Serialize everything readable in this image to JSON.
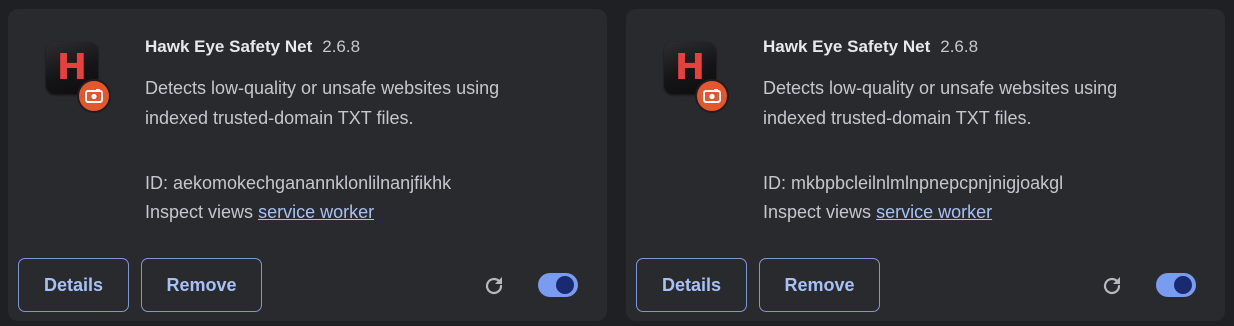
{
  "colors": {
    "page_bg": "#1f2023",
    "card_bg": "#292a2e",
    "accent": "#a8c1f5",
    "toggle_on": "#7a9cf0",
    "icon_red": "#e8413d",
    "badge_orange": "#e4562c"
  },
  "extensions": [
    {
      "icon": "hawk-eye-h-logo",
      "icon_letter": "H",
      "name": "Hawk Eye Safety Net",
      "version": "2.6.8",
      "description": "Detects low-quality or unsafe websites using indexed trusted-domain TXT files.",
      "id_text": "ID: aekomokechganannklonlilnanjfikhk",
      "inspect_label": "Inspect views",
      "inspect_link": "service worker",
      "details_label": "Details",
      "remove_label": "Remove",
      "enabled": true
    },
    {
      "icon": "hawk-eye-h-logo",
      "icon_letter": "H",
      "name": "Hawk Eye Safety Net",
      "version": "2.6.8",
      "description": "Detects low-quality or unsafe websites using indexed trusted-domain TXT files.",
      "id_text": "ID: mkbpbcleilnlmlnpnepcpnjnigjoakgl",
      "inspect_label": "Inspect views",
      "inspect_link": "service worker",
      "details_label": "Details",
      "remove_label": "Remove",
      "enabled": true
    }
  ]
}
